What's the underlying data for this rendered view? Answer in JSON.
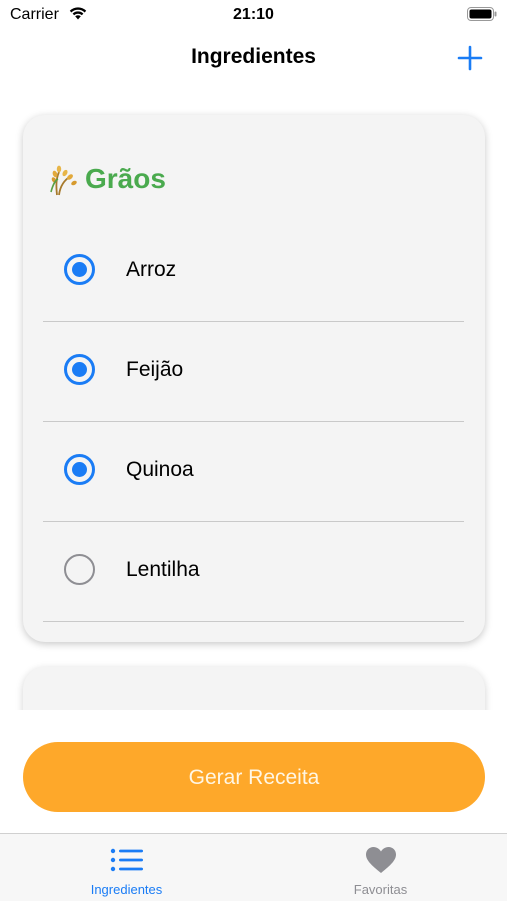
{
  "status_bar": {
    "carrier": "Carrier",
    "time": "21:10"
  },
  "nav": {
    "title": "Ingredientes",
    "add_icon": "plus-icon"
  },
  "section": {
    "title": "Grãos",
    "icon": "grain-icon",
    "items": [
      {
        "label": "Arroz",
        "selected": true
      },
      {
        "label": "Feijão",
        "selected": true
      },
      {
        "label": "Quinoa",
        "selected": true
      },
      {
        "label": "Lentilha",
        "selected": false
      }
    ]
  },
  "cta": {
    "label": "Gerar Receita"
  },
  "tabs": [
    {
      "label": "Ingredientes",
      "icon": "list-icon",
      "active": true
    },
    {
      "label": "Favoritas",
      "icon": "heart-icon",
      "active": false
    }
  ],
  "colors": {
    "accent": "#1a7cf5",
    "section_title": "#4aaa4e",
    "cta_background": "#fea82a",
    "inactive": "#8e8e93"
  }
}
